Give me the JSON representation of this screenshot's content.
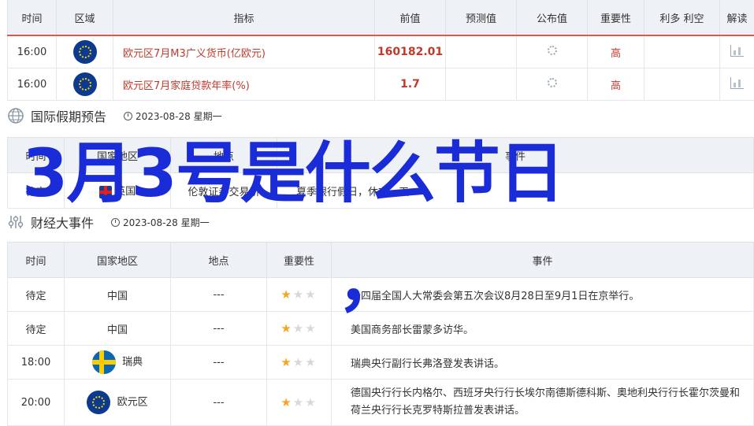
{
  "table1": {
    "headers": [
      "时间",
      "区域",
      "指标",
      "前值",
      "预测值",
      "公布值",
      "重要性",
      "利多 利空",
      "解读"
    ],
    "rows": [
      {
        "time": "16:00",
        "flag": "eu-flag",
        "indicator": "欧元区7月M3广义货币(亿欧元)",
        "prev": "160182.01",
        "forecast": "",
        "actual_icon": "loading-icon",
        "importance": "高",
        "impact": "",
        "interp_icon": "chart-icon"
      },
      {
        "time": "16:00",
        "flag": "eu-flag",
        "indicator": "欧元区7月家庭贷款年率(%)",
        "prev": "1.7",
        "forecast": "",
        "actual_icon": "loading-icon",
        "importance": "高",
        "impact": "",
        "interp_icon": "chart-icon"
      }
    ]
  },
  "holiday": {
    "title": "国际假期预告",
    "date": "2023-08-28 星期一",
    "headers": [
      "时间",
      "国家地区",
      "地点",
      "事件"
    ],
    "rows": [
      {
        "time": "待定",
        "region": "英国",
        "place": "伦敦证券交易所",
        "event": "夏季银行假日，休市一天"
      }
    ]
  },
  "finance": {
    "title": "财经大事件",
    "date": "2023-08-28 星期一",
    "headers": [
      "时间",
      "国家地区",
      "地点",
      "重要性",
      "事件"
    ],
    "rows": [
      {
        "time": "待定",
        "region": "中国",
        "place": "---",
        "stars": 1,
        "event": "十四届全国人大常委会第五次会议8月28日至9月1日在京举行。"
      },
      {
        "time": "待定",
        "region": "中国",
        "place": "---",
        "stars": 1,
        "event": "美国商务部长雷蒙多访华。"
      },
      {
        "time": "18:00",
        "region": "瑞典",
        "place": "---",
        "stars": 1,
        "event": "瑞典央行副行长弗洛登发表讲话。"
      },
      {
        "time": "20:00",
        "region": "欧元区",
        "place": "---",
        "stars": 1,
        "event": "德国央行行长内格尔、西班牙央行行长埃尔南德斯德科斯、奥地利央行行长霍尔茨曼和荷兰央行行长克罗特斯拉普发表讲话。"
      }
    ]
  },
  "overlay": {
    "headline": "3月3号是什么节日",
    "mark": "，"
  },
  "colors": {
    "accent": "#e2564a",
    "overlay": "#1a2bd8",
    "star": "#f5a623"
  }
}
